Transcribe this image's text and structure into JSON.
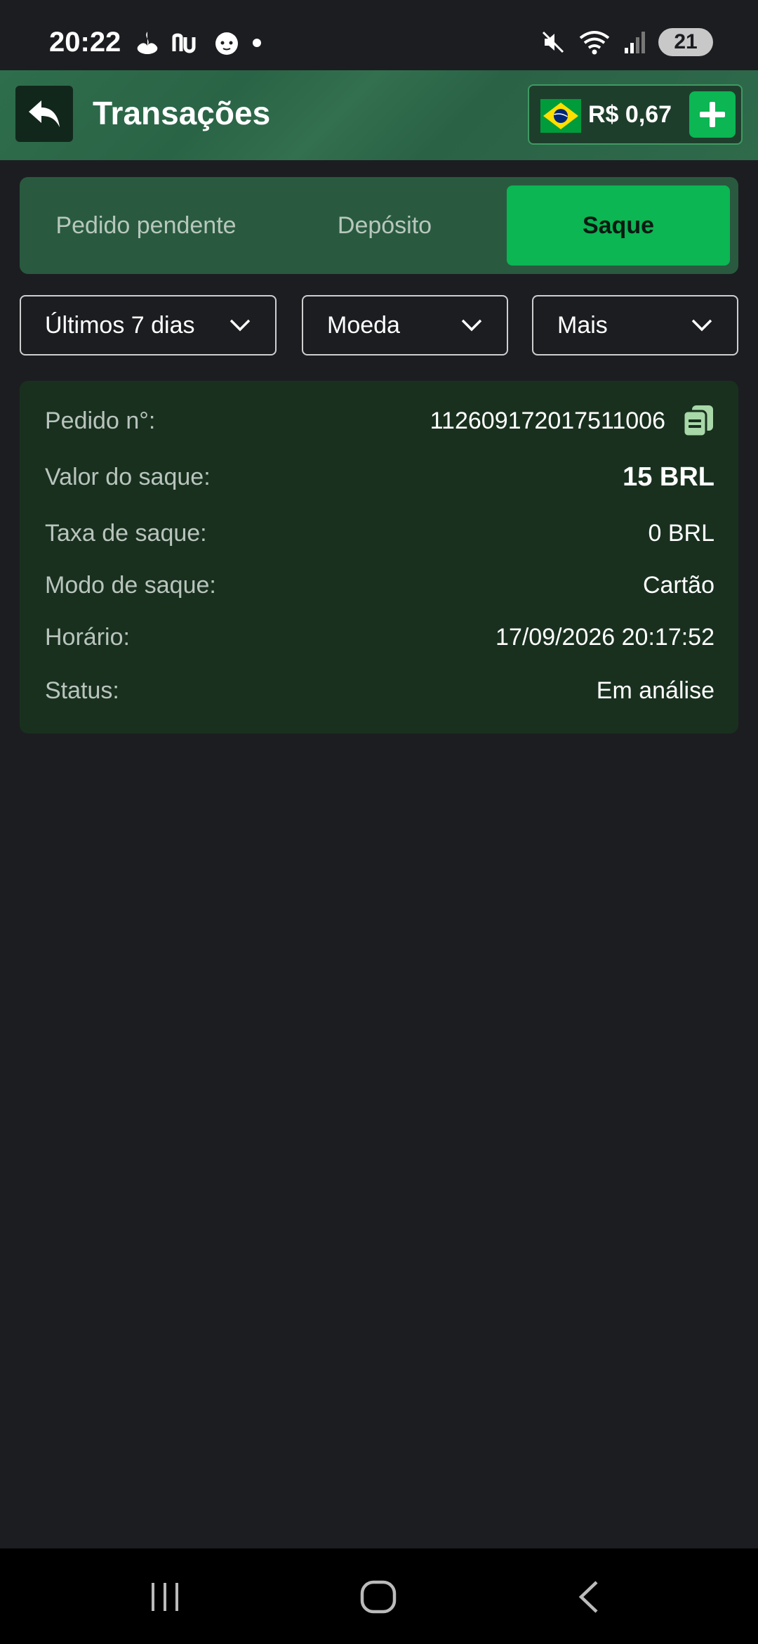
{
  "status_bar": {
    "time": "20:22",
    "battery": "21",
    "left_icons": [
      "santander-icon",
      "nubank-icon",
      "baby-face-icon",
      "dot-icon"
    ],
    "right_icons": [
      "mute-icon",
      "wifi-icon",
      "signal-icon"
    ]
  },
  "header": {
    "title": "Transações",
    "balance": "R$ 0,67"
  },
  "tabs": [
    {
      "label": "Pedido pendente",
      "active": false
    },
    {
      "label": "Depósito",
      "active": false
    },
    {
      "label": "Saque",
      "active": true
    }
  ],
  "filters": [
    {
      "label": "Últimos 7 dias"
    },
    {
      "label": "Moeda"
    },
    {
      "label": "Mais"
    }
  ],
  "transaction": {
    "order_label": "Pedido n°:",
    "order_value": "112609172017511006",
    "amount_label": "Valor do saque:",
    "amount_value": "15 BRL",
    "fee_label": "Taxa de saque:",
    "fee_value": "0 BRL",
    "mode_label": "Modo de saque:",
    "mode_value": "Cartão",
    "time_label": "Horário:",
    "time_value": "17/09/2026 20:17:52",
    "status_label": "Status:",
    "status_value": "Em análise"
  },
  "colors": {
    "accent": "#0bb653",
    "background": "#1c1d21",
    "card": "#19301f",
    "tabs_bg": "#295a3f"
  }
}
